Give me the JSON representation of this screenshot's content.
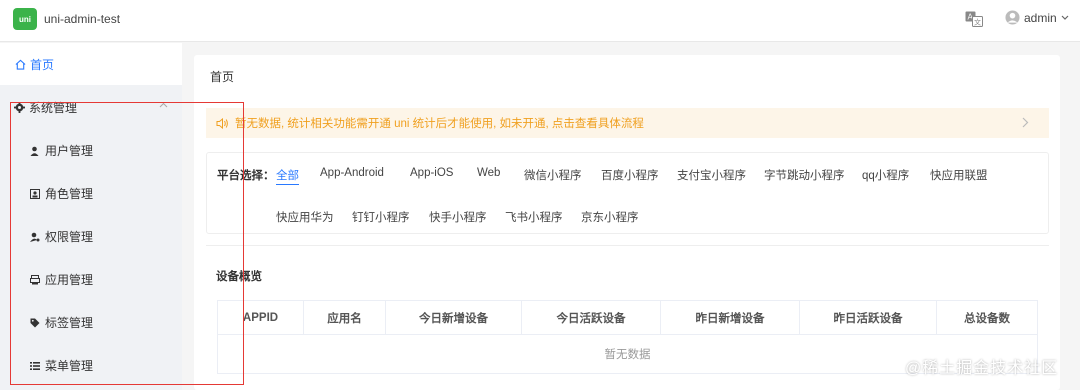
{
  "header": {
    "logo_text": "uni",
    "app_title": "uni-admin-test",
    "user_name": "admin"
  },
  "sidebar": {
    "home": "首页",
    "section": "系统管理",
    "items": [
      {
        "label": "用户管理",
        "icon": "user-icon"
      },
      {
        "label": "角色管理",
        "icon": "role-icon"
      },
      {
        "label": "权限管理",
        "icon": "permission-icon"
      },
      {
        "label": "应用管理",
        "icon": "app-icon"
      },
      {
        "label": "标签管理",
        "icon": "tag-icon"
      },
      {
        "label": "菜单管理",
        "icon": "menu-list-icon"
      }
    ]
  },
  "main": {
    "breadcrumb": "首页",
    "notice": "暂无数据, 统计相关功能需开通 uni 统计后才能使用, 如未开通, 点击查看具体流程",
    "platform_label": "平台选择：",
    "platforms": [
      "全部",
      "App-Android",
      "App-iOS",
      "Web",
      "微信小程序",
      "百度小程序",
      "支付宝小程序",
      "字节跳动小程序",
      "qq小程序",
      "快应用联盟",
      "快应用华为",
      "钉钉小程序",
      "快手小程序",
      "飞书小程序",
      "京东小程序"
    ],
    "overview_title": "设备概览",
    "table_headers": [
      "APPID",
      "应用名",
      "今日新增设备",
      "今日活跃设备",
      "昨日新增设备",
      "昨日活跃设备",
      "总设备数"
    ],
    "empty_text": "暂无数据"
  },
  "watermark": "@稀土掘金技术社区",
  "colors": {
    "accent": "#2979ff",
    "warning": "#f0a020",
    "brand": "#3bb34a",
    "highlight_box": "#e53935"
  }
}
